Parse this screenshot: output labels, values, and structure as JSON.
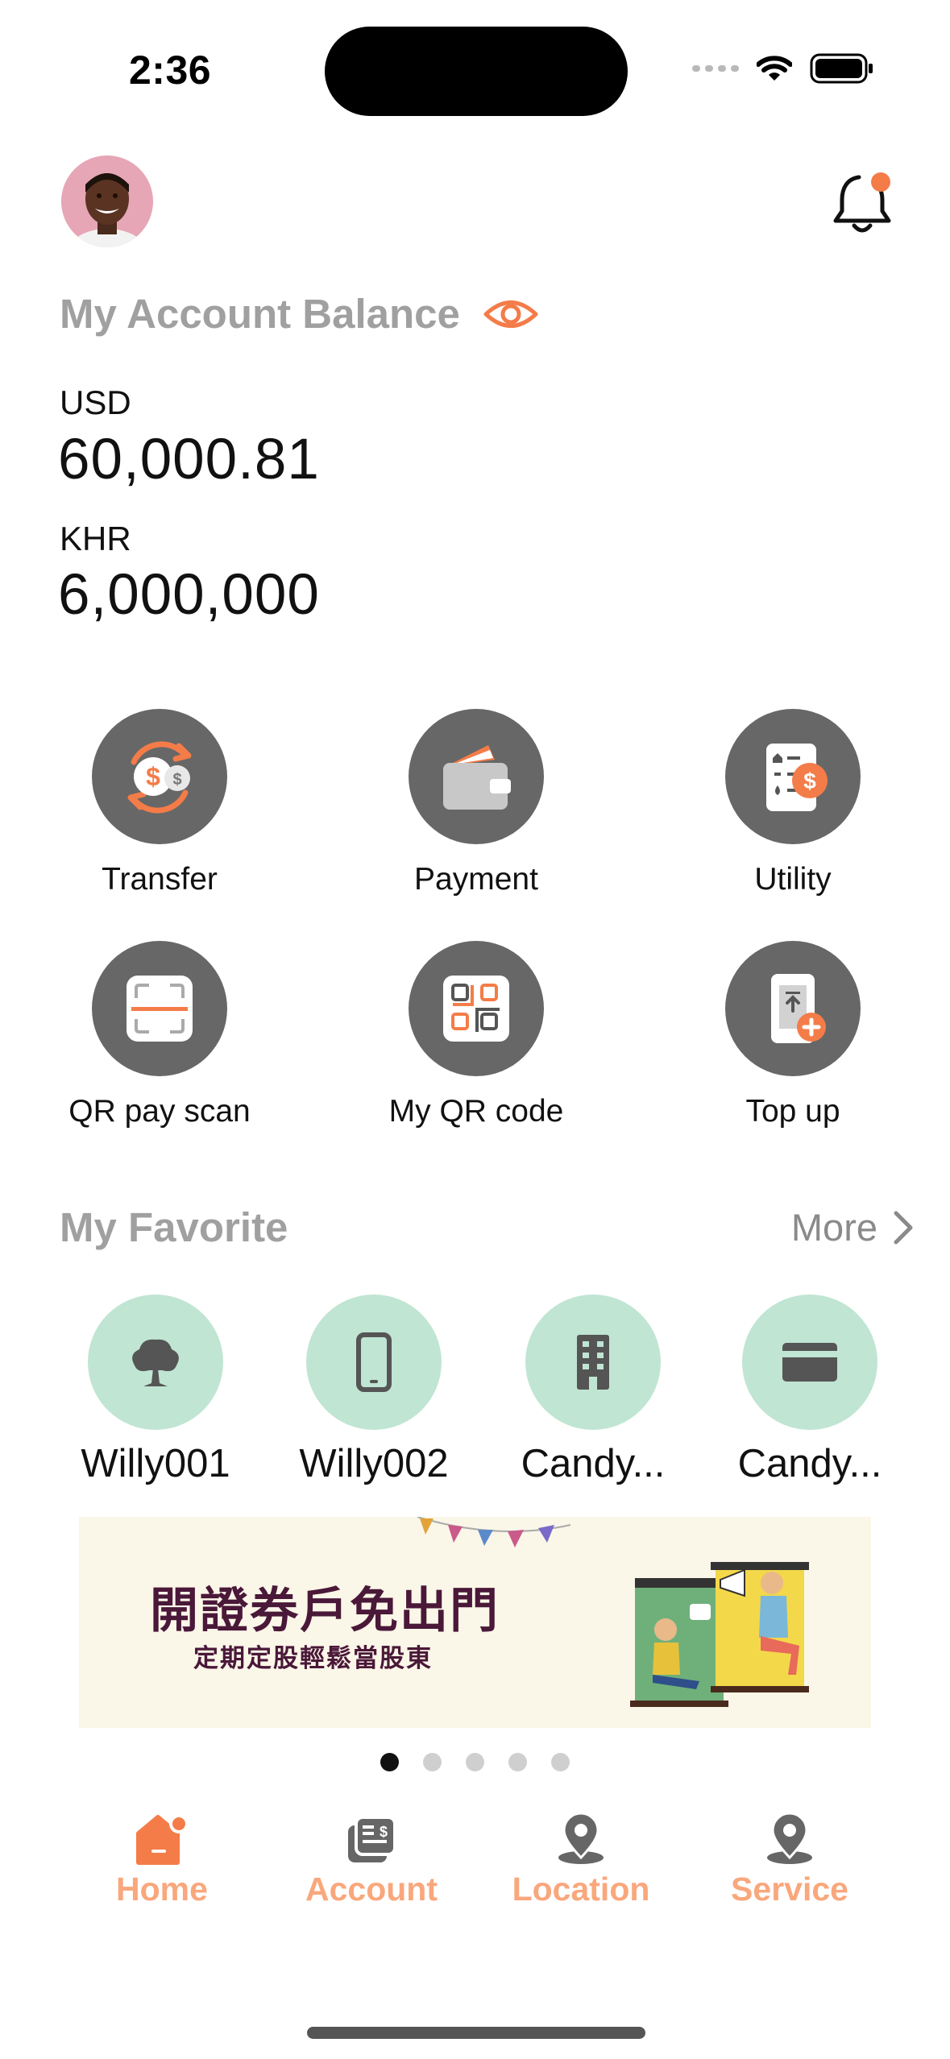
{
  "status_bar": {
    "time": "2:36"
  },
  "header": {
    "avatar_icon": "user-avatar",
    "notification_icon": "bell-icon",
    "notification_dot_color": "#f47c48"
  },
  "balance": {
    "title": "My Account Balance",
    "visibility_icon": "eye-icon",
    "accounts": [
      {
        "currency": "USD",
        "amount": "60,000.81"
      },
      {
        "currency": "KHR",
        "amount": "6,000,000"
      }
    ]
  },
  "actions": [
    {
      "label": "Transfer",
      "icon": "transfer-icon"
    },
    {
      "label": "Payment",
      "icon": "wallet-icon"
    },
    {
      "label": "Utility",
      "icon": "bill-icon"
    },
    {
      "label": "QR pay scan",
      "icon": "scan-icon"
    },
    {
      "label": "My QR code",
      "icon": "qr-code-icon"
    },
    {
      "label": "Top up",
      "icon": "top-up-icon"
    }
  ],
  "favorites": {
    "title": "My Favorite",
    "more_label": "More",
    "items": [
      {
        "label": "Willy001",
        "icon": "tree-icon"
      },
      {
        "label": "Willy002",
        "icon": "phone-icon"
      },
      {
        "label": "Candy...",
        "icon": "building-icon"
      },
      {
        "label": "Candy...",
        "icon": "card-icon"
      }
    ]
  },
  "banner": {
    "title": "開證券戶免出門",
    "subtitle": "定期定股輕鬆當股東",
    "page_count": 5,
    "active_page": 1
  },
  "tab_bar": {
    "accent_color": "#f9a77c",
    "items": [
      {
        "label": "Home",
        "icon": "home-icon",
        "active": true
      },
      {
        "label": "Account",
        "icon": "account-icon",
        "active": false
      },
      {
        "label": "Location",
        "icon": "location-pin-icon",
        "active": false
      },
      {
        "label": "Service",
        "icon": "service-pin-icon",
        "active": false
      }
    ]
  },
  "colors": {
    "accent": "#f47c48",
    "icon_circle": "#676767",
    "favorite_circle": "#c0e5d3",
    "muted_title": "#a0a0a0"
  }
}
